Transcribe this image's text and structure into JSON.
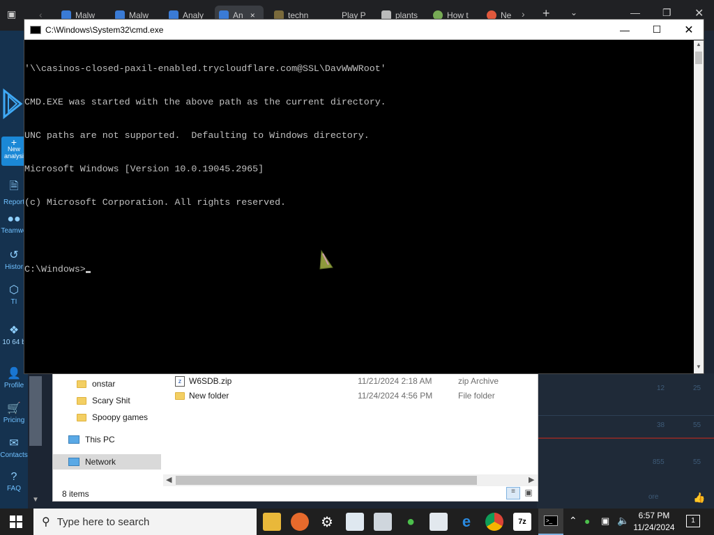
{
  "browser": {
    "tabs": [
      {
        "label": "Malw",
        "color": "#3a7bd5"
      },
      {
        "label": "Malw",
        "color": "#3a7bd5"
      },
      {
        "label": "Analy",
        "color": "#3a7bd5"
      },
      {
        "label": "An",
        "color": "#3a7bd5"
      },
      {
        "label": "techn",
        "color": "#7a6a3b"
      },
      {
        "label": "Play P",
        "color": "#202124"
      },
      {
        "label": "plants",
        "color": "#bbbbbb"
      },
      {
        "label": "How t",
        "color": "#77aa55"
      },
      {
        "label": "Ne",
        "color": "#e0583c"
      }
    ],
    "active_tab_close": "×"
  },
  "sidebar": {
    "new_label": "New analysi",
    "items": [
      {
        "label": "Report",
        "icon": "document-icon"
      },
      {
        "label": "Teamwo",
        "icon": "team-icon"
      },
      {
        "label": "Histor",
        "icon": "history-icon"
      },
      {
        "label": "TI",
        "icon": "ti-icon"
      },
      {
        "label": "10 64 b",
        "icon": "windows-icon"
      },
      {
        "label": "Profile",
        "icon": "profile-icon"
      },
      {
        "label": "Pricing",
        "icon": "cart-icon"
      },
      {
        "label": "Contacts",
        "icon": "mail-icon"
      },
      {
        "label": "FAQ",
        "icon": "faq-icon"
      }
    ]
  },
  "right_pane": {
    "rows": [
      {
        "a": "12",
        "b": "25"
      },
      {
        "a": "38",
        "b": "55"
      },
      {
        "a": "855",
        "b": "55"
      }
    ],
    "footer": "ore"
  },
  "explorer": {
    "nav": [
      {
        "label": "onstar",
        "type": "folder"
      },
      {
        "label": "Scary Shit",
        "type": "folder"
      },
      {
        "label": "Spoopy games",
        "type": "folder"
      },
      {
        "label": "This PC",
        "type": "pc"
      },
      {
        "label": "Network",
        "type": "network"
      }
    ],
    "files": [
      {
        "name": "W6SDB.zip",
        "date": "11/21/2024 2:18 AM",
        "type": "zip Archive"
      },
      {
        "name": "New folder",
        "date": "11/24/2024 4:56 PM",
        "type": "File folder"
      }
    ],
    "status": "8 items"
  },
  "cmd": {
    "title": "C:\\Windows\\System32\\cmd.exe",
    "lines": [
      "'\\\\casinos-closed-paxil-enabled.trycloudflare.com@SSL\\DavWWWRoot'",
      "CMD.EXE was started with the above path as the current directory.",
      "UNC paths are not supported.  Defaulting to Windows directory.",
      "Microsoft Windows [Version 10.0.19045.2965]",
      "(c) Microsoft Corporation. All rights reserved.",
      "",
      "C:\\Windows>"
    ]
  },
  "taskbar": {
    "search_placeholder": "Type here to search",
    "time": "6:57 PM",
    "date": "11/24/2024",
    "notification_count": "1"
  }
}
